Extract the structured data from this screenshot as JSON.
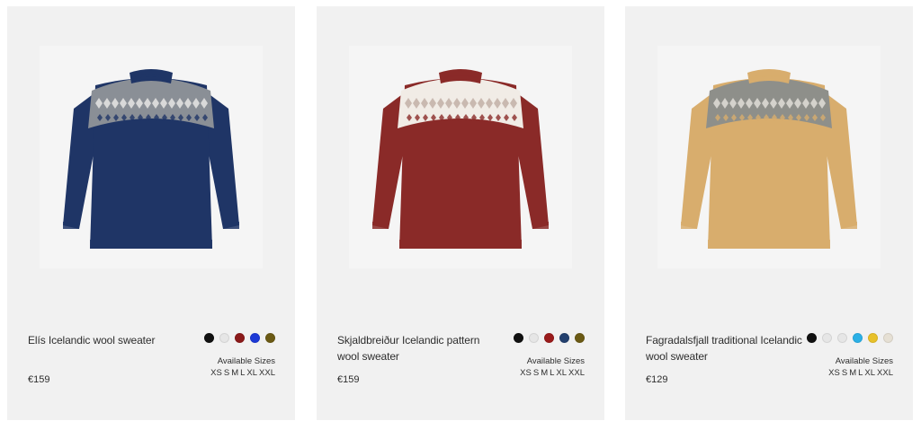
{
  "products": [
    {
      "title": "Elís Icelandic wool sweater",
      "price": "€159",
      "image_icon": "navy-fair-isle-sweater-image",
      "body_color": "#1f3566",
      "yoke_colors": [
        "#8a8f96",
        "#d9d9d9",
        "#1f3566"
      ],
      "swatches": [
        "#111111",
        "#e6e6e6",
        "#8b1a1a",
        "#1c39d6",
        "#6b5a14"
      ],
      "available_sizes_label": "Available Sizes",
      "sizes": [
        "XS",
        "S",
        "M",
        "L",
        "XL",
        "XXL"
      ]
    },
    {
      "title": "Skjaldbreiður Icelandic pattern wool sweater",
      "price": "€159",
      "image_icon": "red-fair-isle-sweater-image",
      "body_color": "#8a2a28",
      "yoke_colors": [
        "#f1ece6",
        "#c9b9b0",
        "#8a2a28"
      ],
      "swatches": [
        "#111111",
        "#e6e6e6",
        "#9a1b1b",
        "#23406e",
        "#6b5a14"
      ],
      "available_sizes_label": "Available Sizes",
      "sizes": [
        "XS",
        "S",
        "M",
        "L",
        "XL",
        "XXL"
      ]
    },
    {
      "title": "Fagradalsfjall traditional Icelandic wool sweater",
      "price": "€129",
      "image_icon": "mustard-fair-isle-sweater-image",
      "body_color": "#d8ad6d",
      "yoke_colors": [
        "#8e8f8a",
        "#d4d2cc",
        "#d8ad6d"
      ],
      "swatches": [
        "#111111",
        "#e6e6e6",
        "#e6e6e6",
        "#2bb0e6",
        "#e8c12a",
        "#e6e0d4"
      ],
      "available_sizes_label": "Available Sizes",
      "sizes": [
        "XS",
        "S",
        "M",
        "L",
        "XL",
        "XXL"
      ]
    }
  ]
}
